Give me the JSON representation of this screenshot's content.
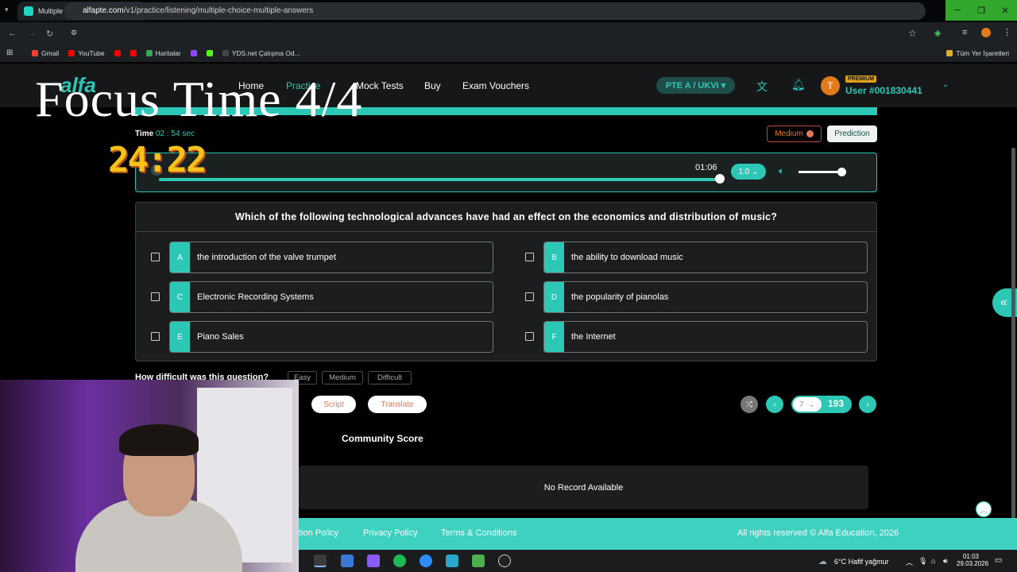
{
  "browser": {
    "tab_title": "Multiple Choice, Multiple Ansv",
    "url_domain": "alfapte.com",
    "url_path": "/v1/practice/listening/multiple-choice-multiple-answers",
    "bookmarks": [
      "Gmail",
      "YouTube",
      "Haritalar",
      "YDS.net Çalışma Od..."
    ],
    "all_bookmarks": "Tüm Yer İşaretleri"
  },
  "overlay": {
    "focus_title": "Focus Time 4/4",
    "timer": "24:22"
  },
  "header": {
    "nav": [
      "Home",
      "Practice",
      "Mock Tests",
      "Buy",
      "Exam Vouchers"
    ],
    "exam_selector": "PTE A / UKVI ▾",
    "avatar_letter": "T",
    "premium": "PREMIUM",
    "user_id": "User #001830441"
  },
  "practice": {
    "time_label": "Time",
    "time_value": "02 : 54 sec",
    "difficulty_badge": "Medium",
    "prediction_label": "Prediction",
    "audio_duration": "01:06",
    "playback_speed": "1.0",
    "volume_level": 0.9,
    "question": "Which of the following technological advances have had an effect on the economics and distribution of music?",
    "options": [
      {
        "letter": "A",
        "text": "the introduction of the valve trumpet"
      },
      {
        "letter": "B",
        "text": "the ability to download music"
      },
      {
        "letter": "C",
        "text": "Electronic Recording Systems"
      },
      {
        "letter": "D",
        "text": "the popularity of pianolas"
      },
      {
        "letter": "E",
        "text": "Piano Sales"
      },
      {
        "letter": "F",
        "text": "the Internet"
      }
    ],
    "difficulty_question": "How difficult was this question?",
    "difficulty_options": [
      "Easy",
      "Medium",
      "Difficult"
    ],
    "script_label": "Script",
    "translate_label": "Translate",
    "current_page": "7",
    "total_pages": "193",
    "community_score": "Community Score",
    "no_record": "No Record Available"
  },
  "footer": {
    "links": [
      "tion Policy",
      "Privacy Policy",
      "Terms & Conditions"
    ],
    "copyright": "All rights reserved © Alfa Education, 2026"
  },
  "taskbar": {
    "weather": "6°C  Hafif yağmur",
    "time": "01:03",
    "date": "29.03.2026"
  },
  "colors": {
    "accent": "#2cc7b5",
    "timer": "#f6c21a",
    "badge": "#e07a1a"
  }
}
